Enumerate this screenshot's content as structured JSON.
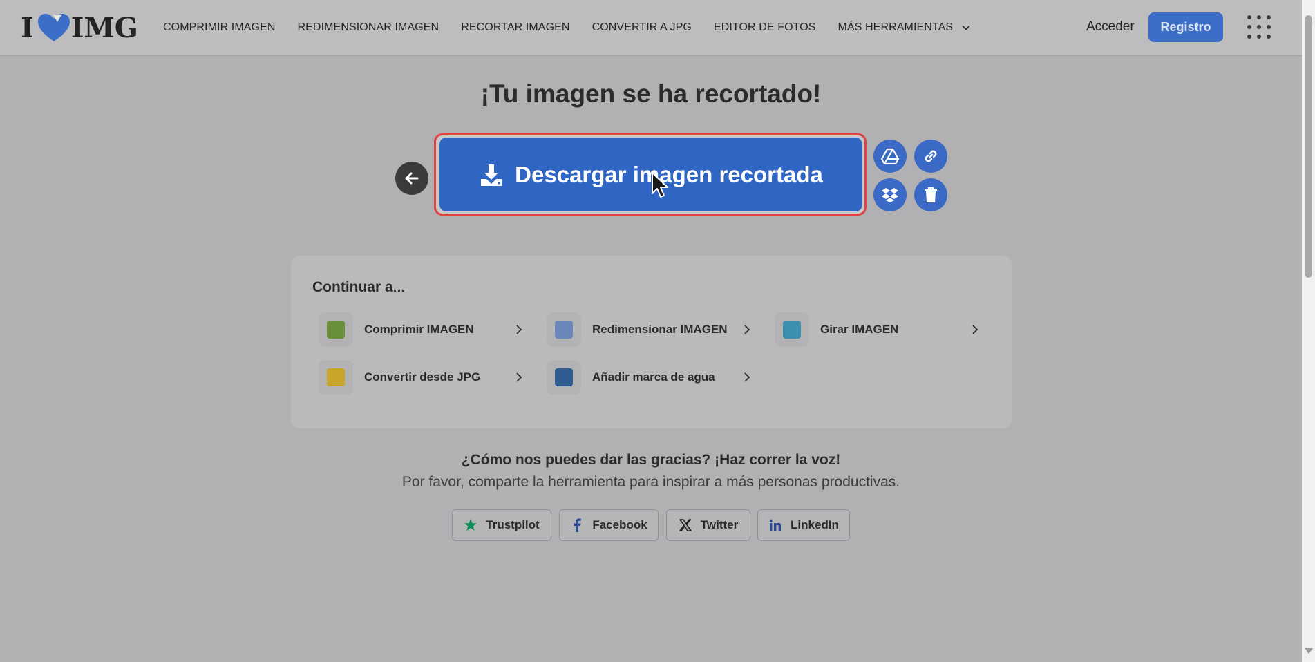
{
  "header": {
    "logo": {
      "left": "I",
      "right": "IMG"
    },
    "nav": [
      {
        "label": "COMPRIMIR IMAGEN"
      },
      {
        "label": "REDIMENSIONAR IMAGEN"
      },
      {
        "label": "RECORTAR IMAGEN"
      },
      {
        "label": "CONVERTIR A JPG"
      },
      {
        "label": "EDITOR DE FOTOS"
      },
      {
        "label": "MÁS HERRAMIENTAS"
      }
    ],
    "login": "Acceder",
    "register": "Registro"
  },
  "main": {
    "title": "¡Tu imagen se ha recortado!",
    "download_label": "Descargar imagen recortada"
  },
  "continue_panel": {
    "title": "Continuar a...",
    "tools": [
      {
        "label": "Comprimir IMAGEN",
        "color": "#6a8f3b"
      },
      {
        "label": "Redimensionar IMAGEN",
        "color": "#6a86b8"
      },
      {
        "label": "Girar IMAGEN",
        "color": "#3d8fb0"
      },
      {
        "label": "Convertir desde JPG",
        "color": "#c7a42a"
      },
      {
        "label": "Añadir marca de agua",
        "color": "#2f5d8f"
      }
    ]
  },
  "share": {
    "title": "¿Cómo nos puedes dar las gracias? ¡Haz correr la voz!",
    "subtitle": "Por favor, comparte la herramienta para inspirar a más personas productivas.",
    "buttons": [
      {
        "label": "Trustpilot"
      },
      {
        "label": "Facebook"
      },
      {
        "label": "Twitter"
      },
      {
        "label": "LinkedIn"
      }
    ]
  },
  "colors": {
    "primary": "#2f66c4",
    "highlight": "#e34242",
    "background": "#b1b1b4"
  }
}
